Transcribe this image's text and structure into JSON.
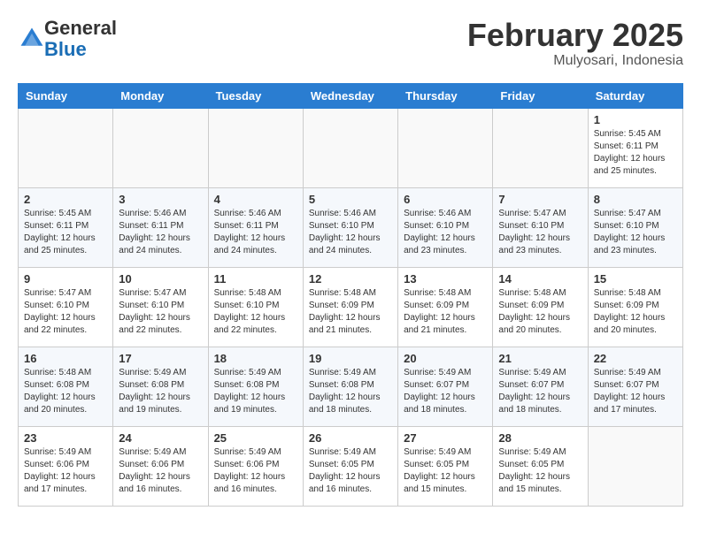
{
  "header": {
    "logo_line1": "General",
    "logo_line2": "Blue",
    "month_title": "February 2025",
    "location": "Mulyosari, Indonesia"
  },
  "days_of_week": [
    "Sunday",
    "Monday",
    "Tuesday",
    "Wednesday",
    "Thursday",
    "Friday",
    "Saturday"
  ],
  "weeks": [
    [
      {
        "day": "",
        "info": ""
      },
      {
        "day": "",
        "info": ""
      },
      {
        "day": "",
        "info": ""
      },
      {
        "day": "",
        "info": ""
      },
      {
        "day": "",
        "info": ""
      },
      {
        "day": "",
        "info": ""
      },
      {
        "day": "1",
        "info": "Sunrise: 5:45 AM\nSunset: 6:11 PM\nDaylight: 12 hours\nand 25 minutes."
      }
    ],
    [
      {
        "day": "2",
        "info": "Sunrise: 5:45 AM\nSunset: 6:11 PM\nDaylight: 12 hours\nand 25 minutes."
      },
      {
        "day": "3",
        "info": "Sunrise: 5:46 AM\nSunset: 6:11 PM\nDaylight: 12 hours\nand 24 minutes."
      },
      {
        "day": "4",
        "info": "Sunrise: 5:46 AM\nSunset: 6:11 PM\nDaylight: 12 hours\nand 24 minutes."
      },
      {
        "day": "5",
        "info": "Sunrise: 5:46 AM\nSunset: 6:10 PM\nDaylight: 12 hours\nand 24 minutes."
      },
      {
        "day": "6",
        "info": "Sunrise: 5:46 AM\nSunset: 6:10 PM\nDaylight: 12 hours\nand 23 minutes."
      },
      {
        "day": "7",
        "info": "Sunrise: 5:47 AM\nSunset: 6:10 PM\nDaylight: 12 hours\nand 23 minutes."
      },
      {
        "day": "8",
        "info": "Sunrise: 5:47 AM\nSunset: 6:10 PM\nDaylight: 12 hours\nand 23 minutes."
      }
    ],
    [
      {
        "day": "9",
        "info": "Sunrise: 5:47 AM\nSunset: 6:10 PM\nDaylight: 12 hours\nand 22 minutes."
      },
      {
        "day": "10",
        "info": "Sunrise: 5:47 AM\nSunset: 6:10 PM\nDaylight: 12 hours\nand 22 minutes."
      },
      {
        "day": "11",
        "info": "Sunrise: 5:48 AM\nSunset: 6:10 PM\nDaylight: 12 hours\nand 22 minutes."
      },
      {
        "day": "12",
        "info": "Sunrise: 5:48 AM\nSunset: 6:09 PM\nDaylight: 12 hours\nand 21 minutes."
      },
      {
        "day": "13",
        "info": "Sunrise: 5:48 AM\nSunset: 6:09 PM\nDaylight: 12 hours\nand 21 minutes."
      },
      {
        "day": "14",
        "info": "Sunrise: 5:48 AM\nSunset: 6:09 PM\nDaylight: 12 hours\nand 20 minutes."
      },
      {
        "day": "15",
        "info": "Sunrise: 5:48 AM\nSunset: 6:09 PM\nDaylight: 12 hours\nand 20 minutes."
      }
    ],
    [
      {
        "day": "16",
        "info": "Sunrise: 5:48 AM\nSunset: 6:08 PM\nDaylight: 12 hours\nand 20 minutes."
      },
      {
        "day": "17",
        "info": "Sunrise: 5:49 AM\nSunset: 6:08 PM\nDaylight: 12 hours\nand 19 minutes."
      },
      {
        "day": "18",
        "info": "Sunrise: 5:49 AM\nSunset: 6:08 PM\nDaylight: 12 hours\nand 19 minutes."
      },
      {
        "day": "19",
        "info": "Sunrise: 5:49 AM\nSunset: 6:08 PM\nDaylight: 12 hours\nand 18 minutes."
      },
      {
        "day": "20",
        "info": "Sunrise: 5:49 AM\nSunset: 6:07 PM\nDaylight: 12 hours\nand 18 minutes."
      },
      {
        "day": "21",
        "info": "Sunrise: 5:49 AM\nSunset: 6:07 PM\nDaylight: 12 hours\nand 18 minutes."
      },
      {
        "day": "22",
        "info": "Sunrise: 5:49 AM\nSunset: 6:07 PM\nDaylight: 12 hours\nand 17 minutes."
      }
    ],
    [
      {
        "day": "23",
        "info": "Sunrise: 5:49 AM\nSunset: 6:06 PM\nDaylight: 12 hours\nand 17 minutes."
      },
      {
        "day": "24",
        "info": "Sunrise: 5:49 AM\nSunset: 6:06 PM\nDaylight: 12 hours\nand 16 minutes."
      },
      {
        "day": "25",
        "info": "Sunrise: 5:49 AM\nSunset: 6:06 PM\nDaylight: 12 hours\nand 16 minutes."
      },
      {
        "day": "26",
        "info": "Sunrise: 5:49 AM\nSunset: 6:05 PM\nDaylight: 12 hours\nand 16 minutes."
      },
      {
        "day": "27",
        "info": "Sunrise: 5:49 AM\nSunset: 6:05 PM\nDaylight: 12 hours\nand 15 minutes."
      },
      {
        "day": "28",
        "info": "Sunrise: 5:49 AM\nSunset: 6:05 PM\nDaylight: 12 hours\nand 15 minutes."
      },
      {
        "day": "",
        "info": ""
      }
    ]
  ]
}
